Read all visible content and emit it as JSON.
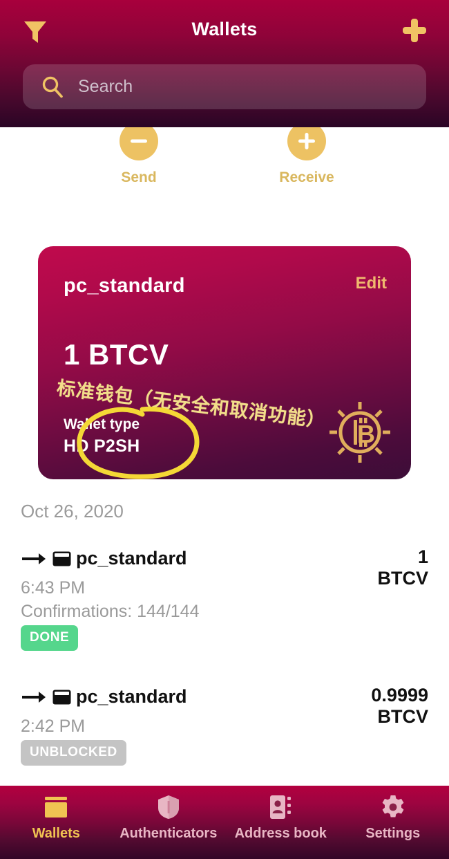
{
  "header": {
    "title": "Wallets",
    "filter_icon": "filter-funnel-icon",
    "add_icon": "plus-icon",
    "search": {
      "icon": "search-icon",
      "placeholder": "Search",
      "value": ""
    }
  },
  "actions": [
    {
      "label": "Send",
      "icon": "minus-circle-icon"
    },
    {
      "label": "Receive",
      "icon": "plus-circle-icon"
    }
  ],
  "wallet_card": {
    "name": "pc_standard",
    "edit_label": "Edit",
    "balance": "1 BTCV",
    "type_label": "Wallet type",
    "type_value": "HD P2SH",
    "logo_icon": "bitcoin-vault-icon",
    "gradient_from": "#c00a4c",
    "gradient_to": "#3c0d38"
  },
  "annotations": {
    "chinese_note": "标准钱包（无安全和取消功能）",
    "note_color": "#f2dd8a",
    "circle_color": "#f4d836",
    "circle_target": "wallet-type"
  },
  "transactions": {
    "date_header": "Oct 26, 2020",
    "items": [
      {
        "direction_icon": "arrow-right-icon",
        "wallet_icon": "wallet-icon",
        "title": "pc_standard",
        "time": "6:43 PM",
        "confirmations": "Confirmations: 144/144",
        "status": "DONE",
        "status_color": "#55d68c",
        "amount": "1",
        "unit": "BTCV"
      },
      {
        "direction_icon": "arrow-right-icon",
        "wallet_icon": "wallet-icon",
        "title": "pc_standard",
        "time": "2:42 PM",
        "confirmations": "",
        "status": "UNBLOCKED",
        "status_color": "#c4c4c4",
        "amount": "0.9999",
        "unit": "BTCV"
      }
    ]
  },
  "bottom_nav": {
    "active": "Wallets",
    "items": [
      {
        "label": "Wallets",
        "icon": "wallet-icon"
      },
      {
        "label": "Authenticators",
        "icon": "shield-icon"
      },
      {
        "label": "Address book",
        "icon": "contact-book-icon"
      },
      {
        "label": "Settings",
        "icon": "gear-icon"
      }
    ]
  }
}
